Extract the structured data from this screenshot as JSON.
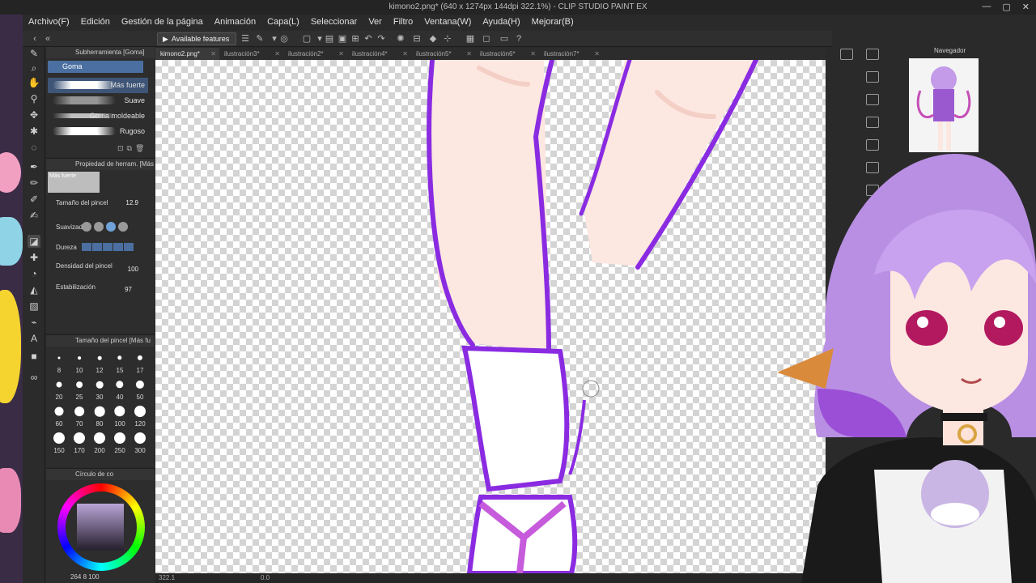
{
  "window": {
    "title": "kimono2.png* (640 x 1274px 144dpi 322.1%) - CLIP STUDIO PAINT EX",
    "buttons": [
      "—",
      "▢",
      "✕"
    ]
  },
  "menu": [
    "Archivo(F)",
    "Edición",
    "Gestión de la página",
    "Animación",
    "Capa(L)",
    "Seleccionar",
    "Ver",
    "Filtro",
    "Ventana(W)",
    "Ayuda(H)",
    "Mejorar(B)"
  ],
  "command_bar": {
    "available_label": "Available features"
  },
  "subtool": {
    "header": "Subherramienta [Goma]",
    "tab": "Goma",
    "brushes": [
      {
        "label": "Más fuerte",
        "selected": true
      },
      {
        "label": "Suave",
        "selected": false
      },
      {
        "label": "Goma moldeable",
        "selected": false
      },
      {
        "label": "Rugoso",
        "selected": false
      }
    ]
  },
  "tool_property": {
    "header": "Propiedad de herram. [Más",
    "preview_label": "Más fuerte",
    "brush_size_label": "Tamaño del pincel",
    "brush_size_value": "12.9",
    "smoothing_label": "Suavizado",
    "hardness_label": "Dureza",
    "density_label": "Densidad del pincel",
    "density_value": "100",
    "stabilization_label": "Estabilización",
    "stabilization_value": "97"
  },
  "brush_size_panel": {
    "header": "Tamaño del pincel [Más fu",
    "sizes": [
      "8",
      "10",
      "12",
      "15",
      "17",
      "20",
      "25",
      "30",
      "40",
      "50",
      "60",
      "70",
      "80",
      "100",
      "120",
      "150",
      "170",
      "200",
      "250",
      "300"
    ]
  },
  "color_panel": {
    "header": "Círculo de co",
    "info": "264  8  100"
  },
  "doc_tabs": [
    {
      "label": "kimono2.png*",
      "active": true
    },
    {
      "label": "ilustración3*",
      "active": false
    },
    {
      "label": "ilustración2*",
      "active": false
    },
    {
      "label": "ilustración4*",
      "active": false
    },
    {
      "label": "ilustración5*",
      "active": false
    },
    {
      "label": "ilustración6*",
      "active": false
    },
    {
      "label": "ilustración7*",
      "active": false
    }
  ],
  "status": {
    "zoom": "322.1",
    "angle": "0.0"
  },
  "navigator": {
    "header": "Navegador"
  },
  "colors": {
    "line_purple": "#8a2be2",
    "skin": "#fde7e1",
    "selection_blue": "#4a6fa0",
    "hair_purple": "#c39be8"
  }
}
